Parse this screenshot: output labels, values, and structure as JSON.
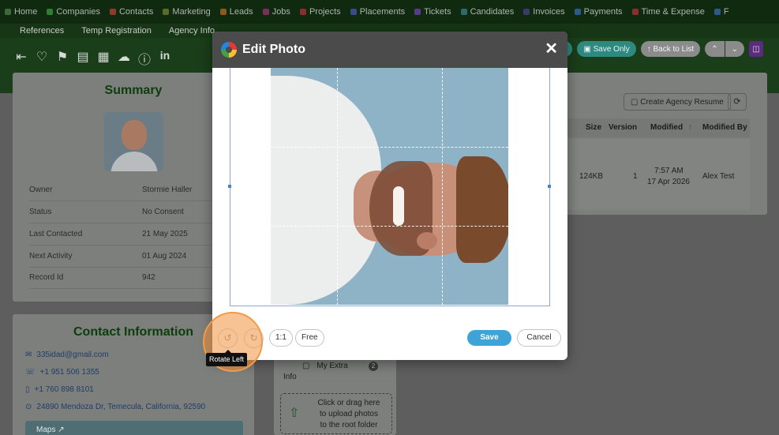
{
  "nav": {
    "items": [
      "Home",
      "Companies",
      "Contacts",
      "Marketing",
      "Leads",
      "Jobs",
      "Projects",
      "Placements",
      "Tickets",
      "Candidates",
      "Invoices",
      "Payments",
      "Time & Expense",
      "F"
    ],
    "colors": [
      "#3a6b3a",
      "#2e7d32",
      "#8e3b2a",
      "#5a6a2a",
      "#8a5a1a",
      "#7a2e5a",
      "#8a2e2e",
      "#3a4a8a",
      "#5a3a8a",
      "#2e6a6a",
      "#3a3a6a",
      "#2e5a8a",
      "#8a2e2e",
      "#2e5a8a"
    ]
  },
  "subnav": {
    "items": [
      "References",
      "Temp Registration",
      "Agency Info"
    ]
  },
  "header_buttons": {
    "close_partial": "ose",
    "save_only": "Save Only",
    "back_to_list": "Back to List",
    "up": "⌃",
    "down": "⌄"
  },
  "summary": {
    "title": "Summary",
    "rows": [
      {
        "label": "Owner",
        "value": "Stormie Haller"
      },
      {
        "label": "Status",
        "value": "No Consent"
      },
      {
        "label": "Last Contacted",
        "value": "21 May 2025"
      },
      {
        "label": "Next Activity",
        "value": "01 Aug 2024"
      },
      {
        "label": "Record Id",
        "value": "942"
      }
    ]
  },
  "contact": {
    "title": "Contact Information",
    "email": "335idad@gmail.com",
    "phone1": "+1 951 506 1355",
    "phone2": "+1 760 898 8101",
    "address": "24890 Mendoza Dr, Temecula, California, 92590",
    "maps": "Maps"
  },
  "documents": {
    "create_resume": "Create Agency Resume",
    "columns": {
      "size": "Size",
      "version": "Version",
      "modified": "Modified",
      "modified_by": "Modified By"
    },
    "row": {
      "size": "124KB",
      "version": "1",
      "modified_time": "7:57 AM",
      "modified_date": "17 Apr 2026",
      "modified_by": "Alex Test"
    }
  },
  "folders": {
    "item_label": "My Extra",
    "item_label2": "Info",
    "item_count": "2",
    "drop_line1": "Click or drag here",
    "drop_line2": "to upload photos",
    "drop_line3": "to the root folder"
  },
  "modal": {
    "title": "Edit Photo",
    "close": "✕",
    "rotate_left": "↺",
    "rotate_right": "↻",
    "ratio_1_1": "1:1",
    "ratio_free": "Free",
    "save": "Save",
    "cancel": "Cancel",
    "tooltip": "Rotate Left"
  }
}
